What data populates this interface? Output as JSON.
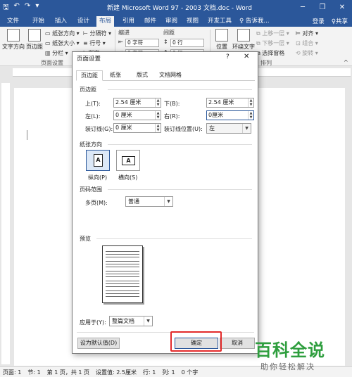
{
  "titlebar": {
    "title": "新建 Microsoft Word 97 - 2003 文档.doc - Word",
    "minimize_icon": "─",
    "restore_icon": "❐",
    "close_icon": "✕"
  },
  "tabs": {
    "items": [
      "文件",
      "开始",
      "插入",
      "设计",
      "布局",
      "引用",
      "邮件",
      "审阅",
      "视图",
      "开发工具"
    ],
    "tell_me": "♀ 告诉我...",
    "login": "登录",
    "share": "♀共享"
  },
  "ribbon": {
    "text_direction": "文字方向",
    "margins": "页边距",
    "orientation": "纸张方向",
    "size": "纸张大小",
    "columns": "分栏",
    "breaks": "分隔符",
    "line_numbers": "行号",
    "hyphenation": "断字",
    "indent": "缩进",
    "indent_left": "0 字符",
    "indent_right": "0 字符",
    "spacing": "间距",
    "spacing_before": "0 行",
    "spacing_after": "0 行",
    "position": "位置",
    "wrap_text": "环绕文字",
    "bring_forward": "上移一层",
    "send_backward": "下移一层",
    "selection_pane": "选择窗格",
    "align": "对齐",
    "group": "组合",
    "rotate": "旋转",
    "group_page_setup": "页面设置",
    "group_arrange": "排列"
  },
  "statusbar": {
    "page": "页面: 1",
    "section": "节: 1",
    "page_of": "第 1 页，共 1 页",
    "set_value": "设置值: 2.5厘米",
    "row": "行: 1",
    "col": "列: 1",
    "chars": "0 个字"
  },
  "dialog": {
    "title": "页面设置",
    "help": "?",
    "close": "✕",
    "tabs": [
      "页边距",
      "纸张",
      "版式",
      "文档网格"
    ],
    "margins_section": "页边距",
    "top_label": "上(T):",
    "top_value": "2.54 厘米",
    "bottom_label": "下(B):",
    "bottom_value": "2.54 厘米",
    "left_label": "左(L):",
    "left_value": "0 厘米",
    "right_label": "右(R):",
    "right_value": "0厘米",
    "gutter_label": "装订线(G):",
    "gutter_value": "0 厘米",
    "gutter_pos_label": "装订线位置(U):",
    "gutter_pos_value": "左",
    "orientation_section": "纸张方向",
    "portrait": "纵向(P)",
    "landscape": "横向(S)",
    "pages_section": "页码范围",
    "multiple_pages_label": "多页(M):",
    "multiple_pages_value": "普通",
    "preview_section": "预览",
    "apply_label": "应用于(Y):",
    "apply_value": "整篇文档",
    "default_button": "设为默认值(D)",
    "ok_button": "确定",
    "cancel_button": "取消"
  },
  "watermark": {
    "line1": "百科全说",
    "line2": "助你轻松解决"
  },
  "colors": {
    "accent": "#2b579a",
    "highlight": "#e32b2b",
    "watermark": "#2e9e3e"
  }
}
